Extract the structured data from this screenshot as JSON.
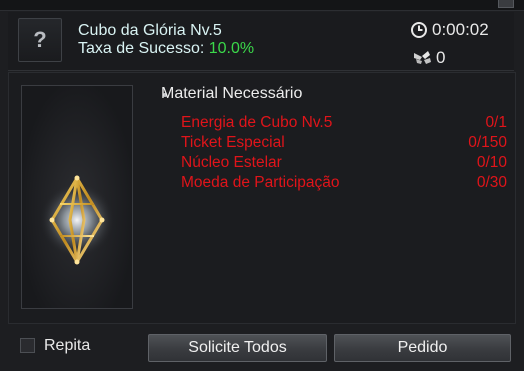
{
  "header": {
    "item_name": "Cubo da Glória Nv.5",
    "success_label": "Taxa de Sucesso:",
    "success_rate": "10.0%",
    "timer": "0:00:02",
    "count": "0",
    "unknown_icon": "question-mark-icon"
  },
  "materials": {
    "title": "Material Necessário",
    "items": [
      {
        "name": "Energia de Cubo Nv.5",
        "amount": "0/1"
      },
      {
        "name": "Ticket Especial",
        "amount": "0/150"
      },
      {
        "name": "Núcleo Estelar",
        "amount": "0/10"
      },
      {
        "name": "Moeda de Participação",
        "amount": "0/30"
      }
    ],
    "missing_color": "#e0141a"
  },
  "footer": {
    "repeat_label": "Repita",
    "repeat_checked": false,
    "request_all_label": "Solicite Todos",
    "order_label": "Pedido"
  },
  "colors": {
    "rate": "#3bd84a",
    "item_text": "#d9f3f3"
  }
}
